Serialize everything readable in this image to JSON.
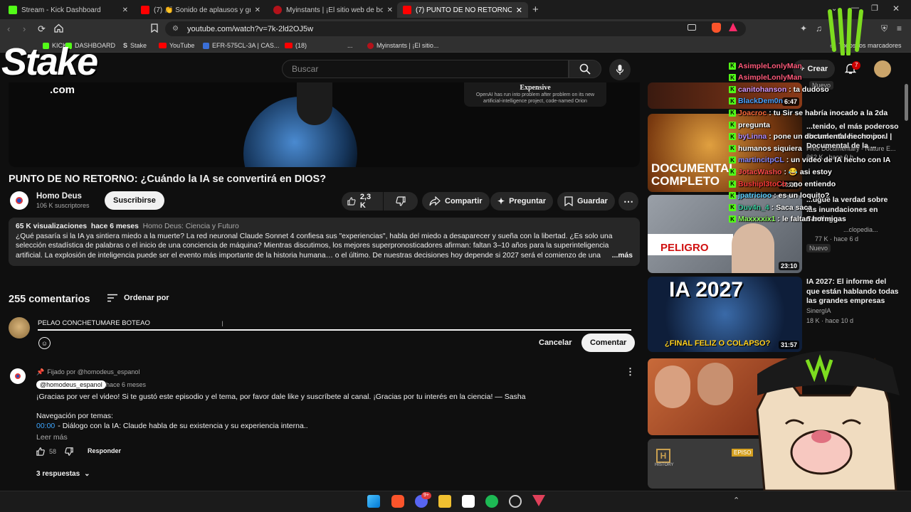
{
  "browser": {
    "tabs": [
      {
        "label": "Stream - Kick Dashboard",
        "icon": "kick-icon"
      },
      {
        "label": "(7) 👏 Sonido de aplausos y gritos de",
        "icon": "youtube-icon"
      },
      {
        "label": "Myinstants | ¡El sitio web de botones",
        "icon": "myinstants-icon"
      },
      {
        "label": "(7) PUNTO DE NO RETORNO: ¿C",
        "icon": "youtube-icon"
      }
    ],
    "url": "youtube.com/watch?v=7k-2ld2OJ5w",
    "bookmarks": [
      "KICK",
      "DASHBOARD",
      "Stake",
      "YouTube",
      "EFR-575CL-3A | CAS...",
      "(18)",
      "...",
      "Myinstants | ¡El sitio..."
    ],
    "all_bookmarks": "Todos los marcadores"
  },
  "overlay": {
    "stake_logo": "Stake",
    "stake_sub": ".com"
  },
  "youtube": {
    "search_placeholder": "Buscar",
    "create_label": "Crear",
    "notifications_count": "7",
    "video_overlay_title": "Expensive",
    "video_overlay_text": "OpenAI has run into problem after problem on its new artificial-intelligence project, code-named Orion",
    "title": "PUNTO DE NO RETORNO: ¿Cuándo la IA se convertirá en DIOS?",
    "channel": {
      "name": "Homo Deus",
      "subs": "106 K suscriptores",
      "subscribe": "Suscribirse"
    },
    "actions": {
      "likes": "2,3 K",
      "share": "Compartir",
      "ask": "Preguntar",
      "save": "Guardar"
    },
    "description": {
      "views": "65 K visualizaciones",
      "ago": "hace 6 meses",
      "tag": "Homo Deus: Ciencia y Futuro",
      "line1": "¿Qué pasaría si la IA ya sintiera miedo a la muerte? La red neuronal Claude Sonnet 4 confiesa sus \"experiencias\", habla del miedo a desaparecer y sueña con la libertad. ¿Es solo una",
      "line2": "selección estadística de palabras o el inicio de una conciencia de máquina? Mientras discutimos, los mejores superpronosticadores afirman: faltan 3–10 años para la superinteligencia",
      "line3": "artificial. La explosión de inteligencia puede ser el evento más importante de la historia humana… o el último. De nuestras decisiones hoy depende si 2027 será el comienzo de una",
      "more": "...más"
    },
    "comments": {
      "count": "255 comentarios",
      "sort": "Ordenar por",
      "draft": "PELAO CONCHETUMARE BOTEAO",
      "cancel": "Cancelar",
      "submit": "Comentar",
      "pinned": {
        "pinned_by": "Fijado por @homodeus_espanol",
        "author": "@homodeus_espanol",
        "ago": "hace 6 meses",
        "text": "¡Gracias por ver el video! Si te gustó este episodio y el tema, por favor dale like y suscríbete al canal. ¡Gracias por tu interés en la ciencia! — Sasha",
        "nav": "Navegación por temas:",
        "timestamp": "00:00",
        "timestamp_text": "- Diálogo con la IA: Claude habla de su existencia y su experiencia interna..",
        "read_more": "Leer más",
        "likes": "58",
        "reply": "Responder",
        "replies": "3 respuestas"
      }
    },
    "sidebar": [
      {
        "title": "",
        "meta1": "Nuevo",
        "meta2": "",
        "duration": "6:47"
      },
      {
        "title": "...tenido, el más poderoso de todo el reino animal | Documental de la ...",
        "meta1": "Free Documentary - Nature E...",
        "meta2": "362 K · hace 9 h",
        "duration": "48:01"
      },
      {
        "title": "...ugué la verdad sobre las inundaciones en Santiago",
        "meta1": "...clopedia...",
        "meta2": "77 K · hace 6 d",
        "duration": "23:10",
        "badge": "Nuevo"
      },
      {
        "title": "IA 2027: El informe del que están hablando todas las grandes empresas",
        "meta1": "SinergIA",
        "meta2": "18 K · hace 10 d",
        "duration": "31:57"
      },
      {
        "title": "",
        "meta1": "",
        "meta2": "",
        "duration": ""
      },
      {
        "title": "",
        "meta1": "",
        "meta2": "",
        "duration": ""
      }
    ],
    "thumb_text": {
      "documental": "DOCUMENTAL",
      "completo": "COMPLETO",
      "peligro": "PELIGRO",
      "ia2027": "IA 2027",
      "final": "¿FINAL FELIZ O COLAPSO?",
      "history": "HISTORY",
      "episo": "EPISO"
    }
  },
  "chat": [
    {
      "user": "AsimpleLonlyMan",
      "msg": "",
      "color": "#ff5a7a"
    },
    {
      "user": "AsimpleLonlyMan",
      "msg": "",
      "color": "#ff5a7a"
    },
    {
      "user": "canitohanson",
      "msg": ": ta dudoso",
      "color": "#d89aff"
    },
    {
      "user": "BlackDem0n",
      "msg": "",
      "color": "#4aa3ff"
    },
    {
      "user": "Joacroc",
      "msg": ": tu Sir se habría inocado a la 2da",
      "color": "#ff6a3a"
    },
    {
      "user": "pregunta",
      "msg": "",
      "color": "#ffffff"
    },
    {
      "user": "byLinna",
      "msg": ": pone un documental hecho por",
      "color": "#b28cff"
    },
    {
      "user": "humanos siquiera",
      "msg": "",
      "color": "#ffffff"
    },
    {
      "user": "martincitpCL",
      "msg": ": un video de IA hecho con IA",
      "color": "#8a8aff"
    },
    {
      "user": "JotacWasho",
      "msg": ": 😂 asi estoy",
      "color": "#ff4a4a"
    },
    {
      "user": "Bushipl3toCb",
      "msg": ": no entiendo",
      "color": "#ff3a3a"
    },
    {
      "user": "jpatricioo",
      "msg": ": es un loquito?",
      "color": "#5bd0ff"
    },
    {
      "user": "Duv4n_4",
      "msg": ": Saca saca",
      "color": "#3ad0a0"
    },
    {
      "user": "Maxxxxix1",
      "msg": ": le faltan hormigas",
      "color": "#8aff5a"
    }
  ],
  "taskbar": {
    "discord_badge": "9+"
  },
  "colors": {
    "accent": "#ff0000",
    "kick": "#53fc18",
    "bg": "#0f0f0f"
  }
}
